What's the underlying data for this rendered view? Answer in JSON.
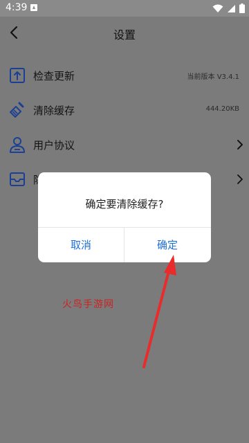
{
  "status_bar": {
    "time": "4:39"
  },
  "header": {
    "title": "设置"
  },
  "settings": {
    "items": [
      {
        "label": "检查更新",
        "value": "当前版本 V3.4.1"
      },
      {
        "label": "清除缓存",
        "value": "444.20KB"
      },
      {
        "label": "用户协议",
        "value": ""
      },
      {
        "label": "隐",
        "value": ""
      }
    ]
  },
  "dialog": {
    "message": "确定要清除缓存?",
    "cancel_label": "取消",
    "confirm_label": "确定"
  },
  "watermark": {
    "text": "火鸟手游网"
  },
  "colors": {
    "accent": "#1f6fd6",
    "icon_blue": "#1b3f92",
    "arrow": "#e82c2c",
    "overlay": "#7b7b7b"
  }
}
